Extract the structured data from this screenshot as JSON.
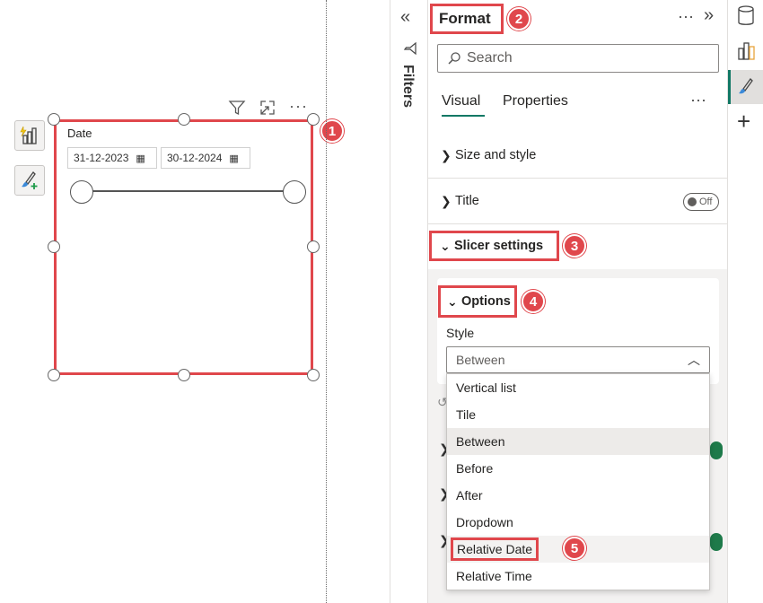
{
  "visual": {
    "toolbar_icons": [
      "filter-icon",
      "focus-mode-icon",
      "more-options-icon"
    ],
    "slicer_title": "Date",
    "start_date": "31-12-2023",
    "end_date": "30-12-2024",
    "badge": "1"
  },
  "filters": {
    "collapse_icon": "double-chevron-left-icon",
    "label": "Filters"
  },
  "format_pane": {
    "title": "Format",
    "badge_title": "2",
    "more_label": "···",
    "search_placeholder": "Search",
    "tabs": [
      {
        "label": "Visual",
        "active": true
      },
      {
        "label": "Properties",
        "active": false
      }
    ],
    "tabs_more": "···",
    "sections": {
      "size_style": "Size and style",
      "title": "Title",
      "title_toggle": "Off",
      "slicer_settings": "Slicer settings",
      "badge_slicer": "3"
    },
    "options": {
      "label": "Options",
      "badge": "4",
      "style_label": "Style",
      "style_value": "Between"
    },
    "dropdown": {
      "items": [
        "Vertical list",
        "Tile",
        "Between",
        "Before",
        "After",
        "Dropdown",
        "Relative Date",
        "Relative Time"
      ],
      "selected": "Between",
      "highlighted": "Relative Date",
      "badge": "5"
    }
  },
  "colors": {
    "annotation": "#e0474c",
    "accent_green": "#1e7a4a",
    "tab_underline": "#117865"
  }
}
